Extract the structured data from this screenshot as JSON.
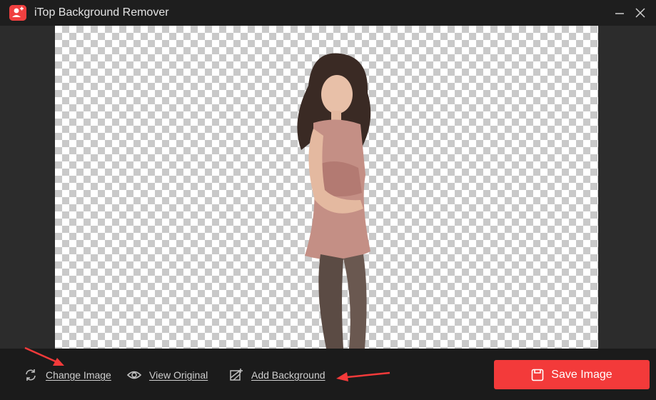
{
  "app": {
    "title": "iTop Background Remover"
  },
  "icons": {
    "logo": "app-logo-icon",
    "minimize": "minimize-icon",
    "close": "close-icon",
    "change": "refresh-icon",
    "view": "eye-icon",
    "add_background": "image-add-icon",
    "save": "save-icon"
  },
  "toolbar": {
    "change_image": "Change Image",
    "view_original": "View Original",
    "add_background": "Add Background",
    "save_image": "Save Image"
  },
  "colors": {
    "accent": "#f33a3a",
    "background": "#1b1b1b",
    "checker_light": "#ffffff",
    "checker_dark": "#c9c9c9"
  }
}
